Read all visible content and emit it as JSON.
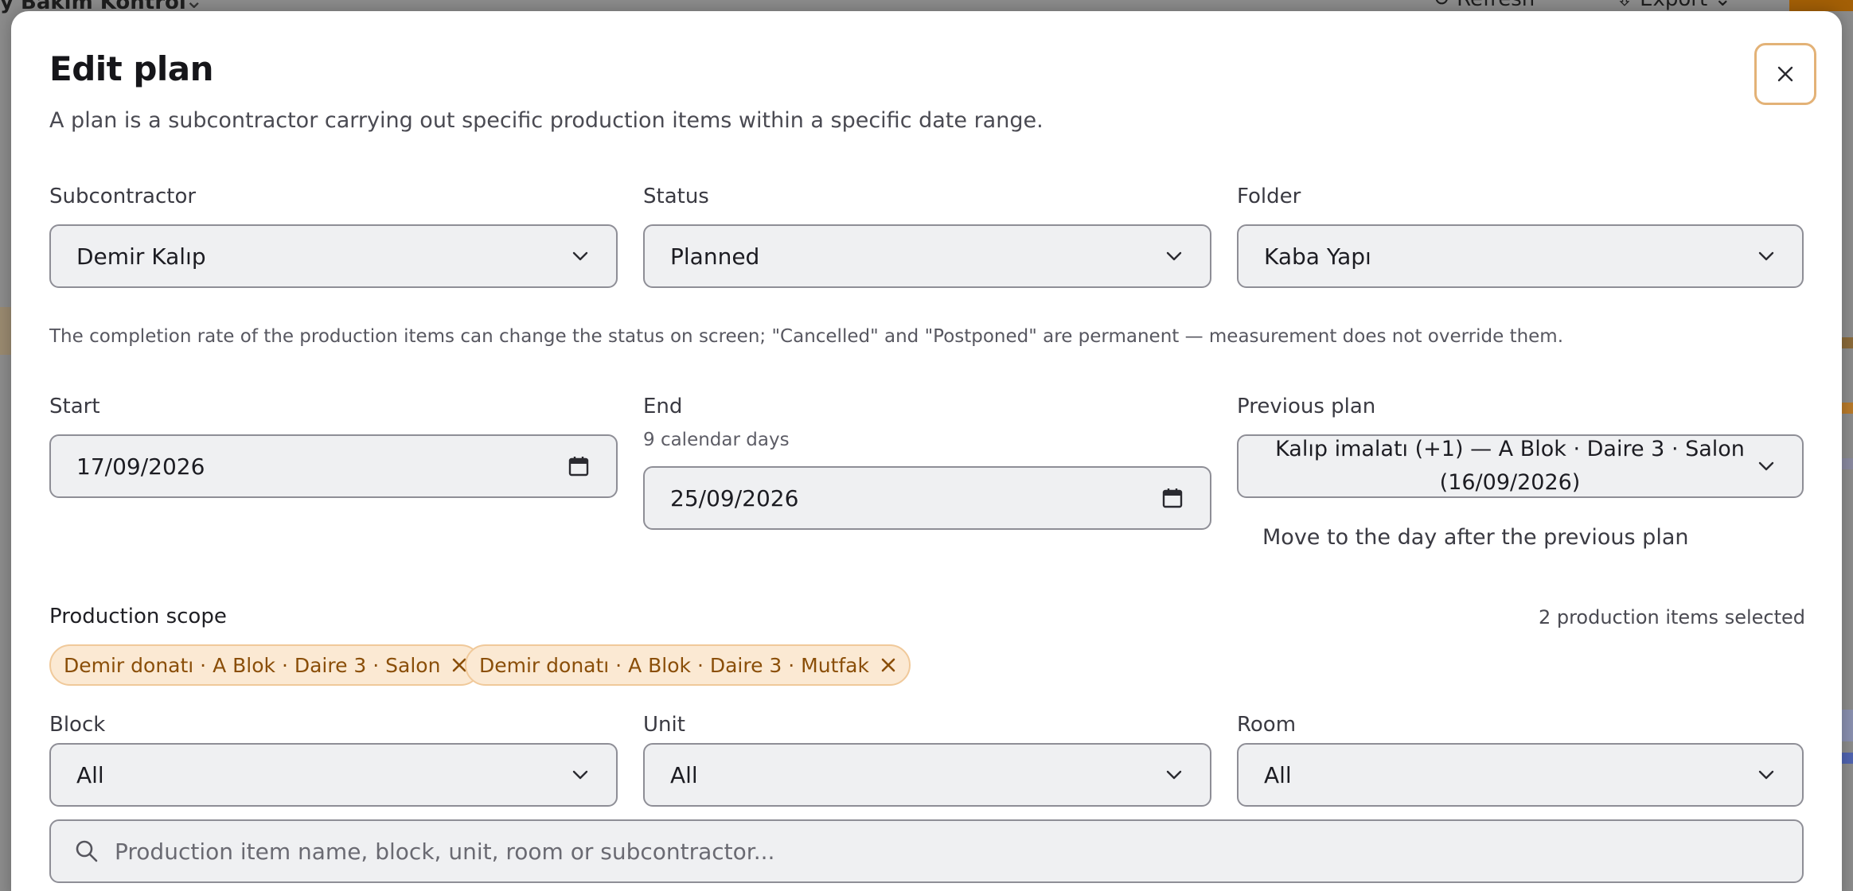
{
  "background": {
    "tab_title": "y Bakım Kontrol",
    "refresh_label": "Refresh",
    "export_label": "Export"
  },
  "modal": {
    "title": "Edit plan",
    "description": "A plan is a subcontractor carrying out specific production items within a specific date range.",
    "close_icon": "close-icon"
  },
  "fields": {
    "subcontractor": {
      "label": "Subcontractor",
      "value": "Demir Kalıp"
    },
    "status": {
      "label": "Status",
      "value": "Planned"
    },
    "folder": {
      "label": "Folder",
      "value": "Kaba Yapı"
    },
    "status_hint": "The completion rate of the production items can change the status on screen; \"Cancelled\" and \"Postponed\" are permanent — measurement does not override them.",
    "start": {
      "label": "Start",
      "value": "17/09/2026"
    },
    "end": {
      "label": "End",
      "sublabel": "9 calendar days",
      "value": "25/09/2026"
    },
    "previous_plan": {
      "label": "Previous plan",
      "value": "Kalıp imalatı (+1) — A Blok · Daire 3 · Salon (16/09/2026)",
      "action": "Move to the day after the previous plan"
    }
  },
  "scope": {
    "label": "Production scope",
    "count_text": "2 production items selected",
    "chips": [
      {
        "label": "Demir donatı · A Blok · Daire 3 · Salon"
      },
      {
        "label": "Demir donatı · A Blok · Daire 3 · Mutfak"
      }
    ]
  },
  "filters": {
    "block": {
      "label": "Block",
      "value": "All"
    },
    "unit": {
      "label": "Unit",
      "value": "All"
    },
    "room": {
      "label": "Room",
      "value": "All"
    }
  },
  "search": {
    "placeholder": "Production item name, block, unit, room or subcontractor..."
  },
  "colors": {
    "accent": "#e3b277",
    "chip_bg": "#fbe9d3",
    "chip_text": "#8a4e08",
    "field_bg": "#eff0f2"
  }
}
